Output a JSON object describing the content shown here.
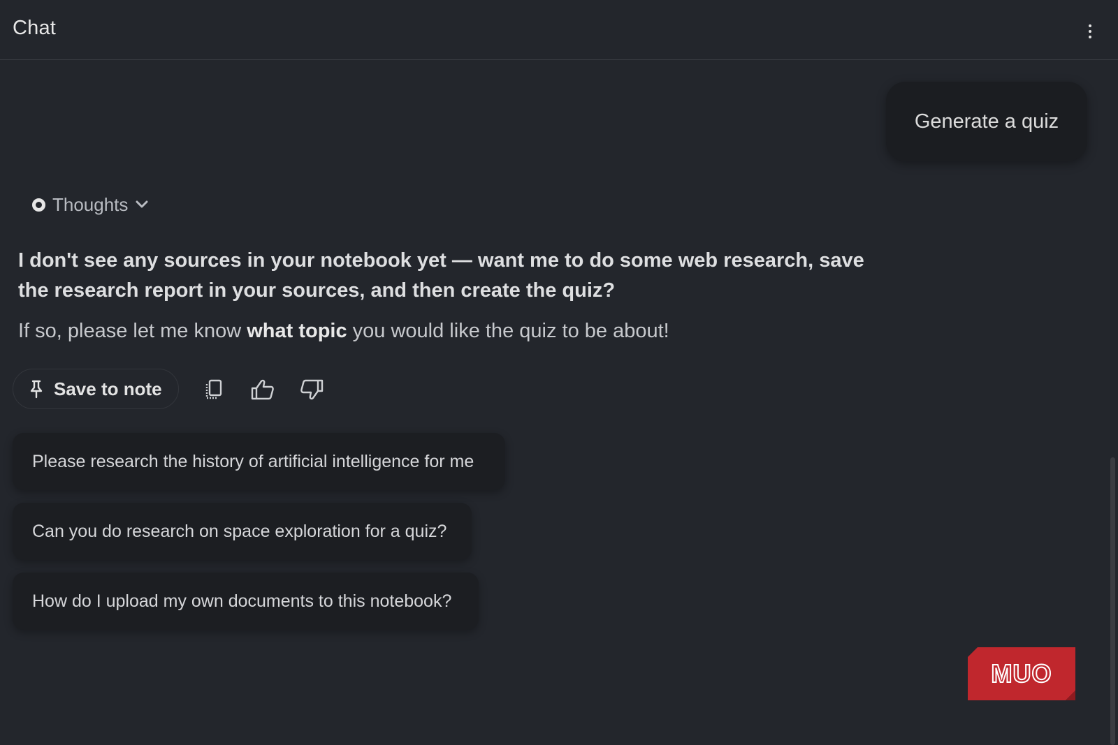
{
  "header": {
    "title": "Chat",
    "more_icon": "more-vert-icon"
  },
  "user_message": {
    "text": "Generate a quiz"
  },
  "thoughts": {
    "label": "Thoughts",
    "icon": "chevron-down-icon"
  },
  "response": {
    "bold_text": "I don't see any sources in your notebook yet — want me to do some web research, save the research report in your sources, and then create the quiz?",
    "line_prefix": "If so, please let me know ",
    "line_emphasis": "what topic",
    "line_suffix": " you would like the quiz to be about!"
  },
  "actions": {
    "save_label": "Save to note",
    "save_icon": "pin-icon",
    "copy_icon": "copy-icon",
    "like_icon": "thumbs-up-icon",
    "dislike_icon": "thumbs-down-icon"
  },
  "suggestions": [
    "Please research the history of artificial intelligence for me",
    "Can you do research on space exploration for a quiz?",
    "How do I upload my own documents to this notebook?"
  ],
  "logo": {
    "text": "MUO",
    "color": "#c0272d"
  },
  "colors": {
    "background": "#23262c",
    "bubble": "#1b1d21",
    "text": "#e3e3e3"
  }
}
